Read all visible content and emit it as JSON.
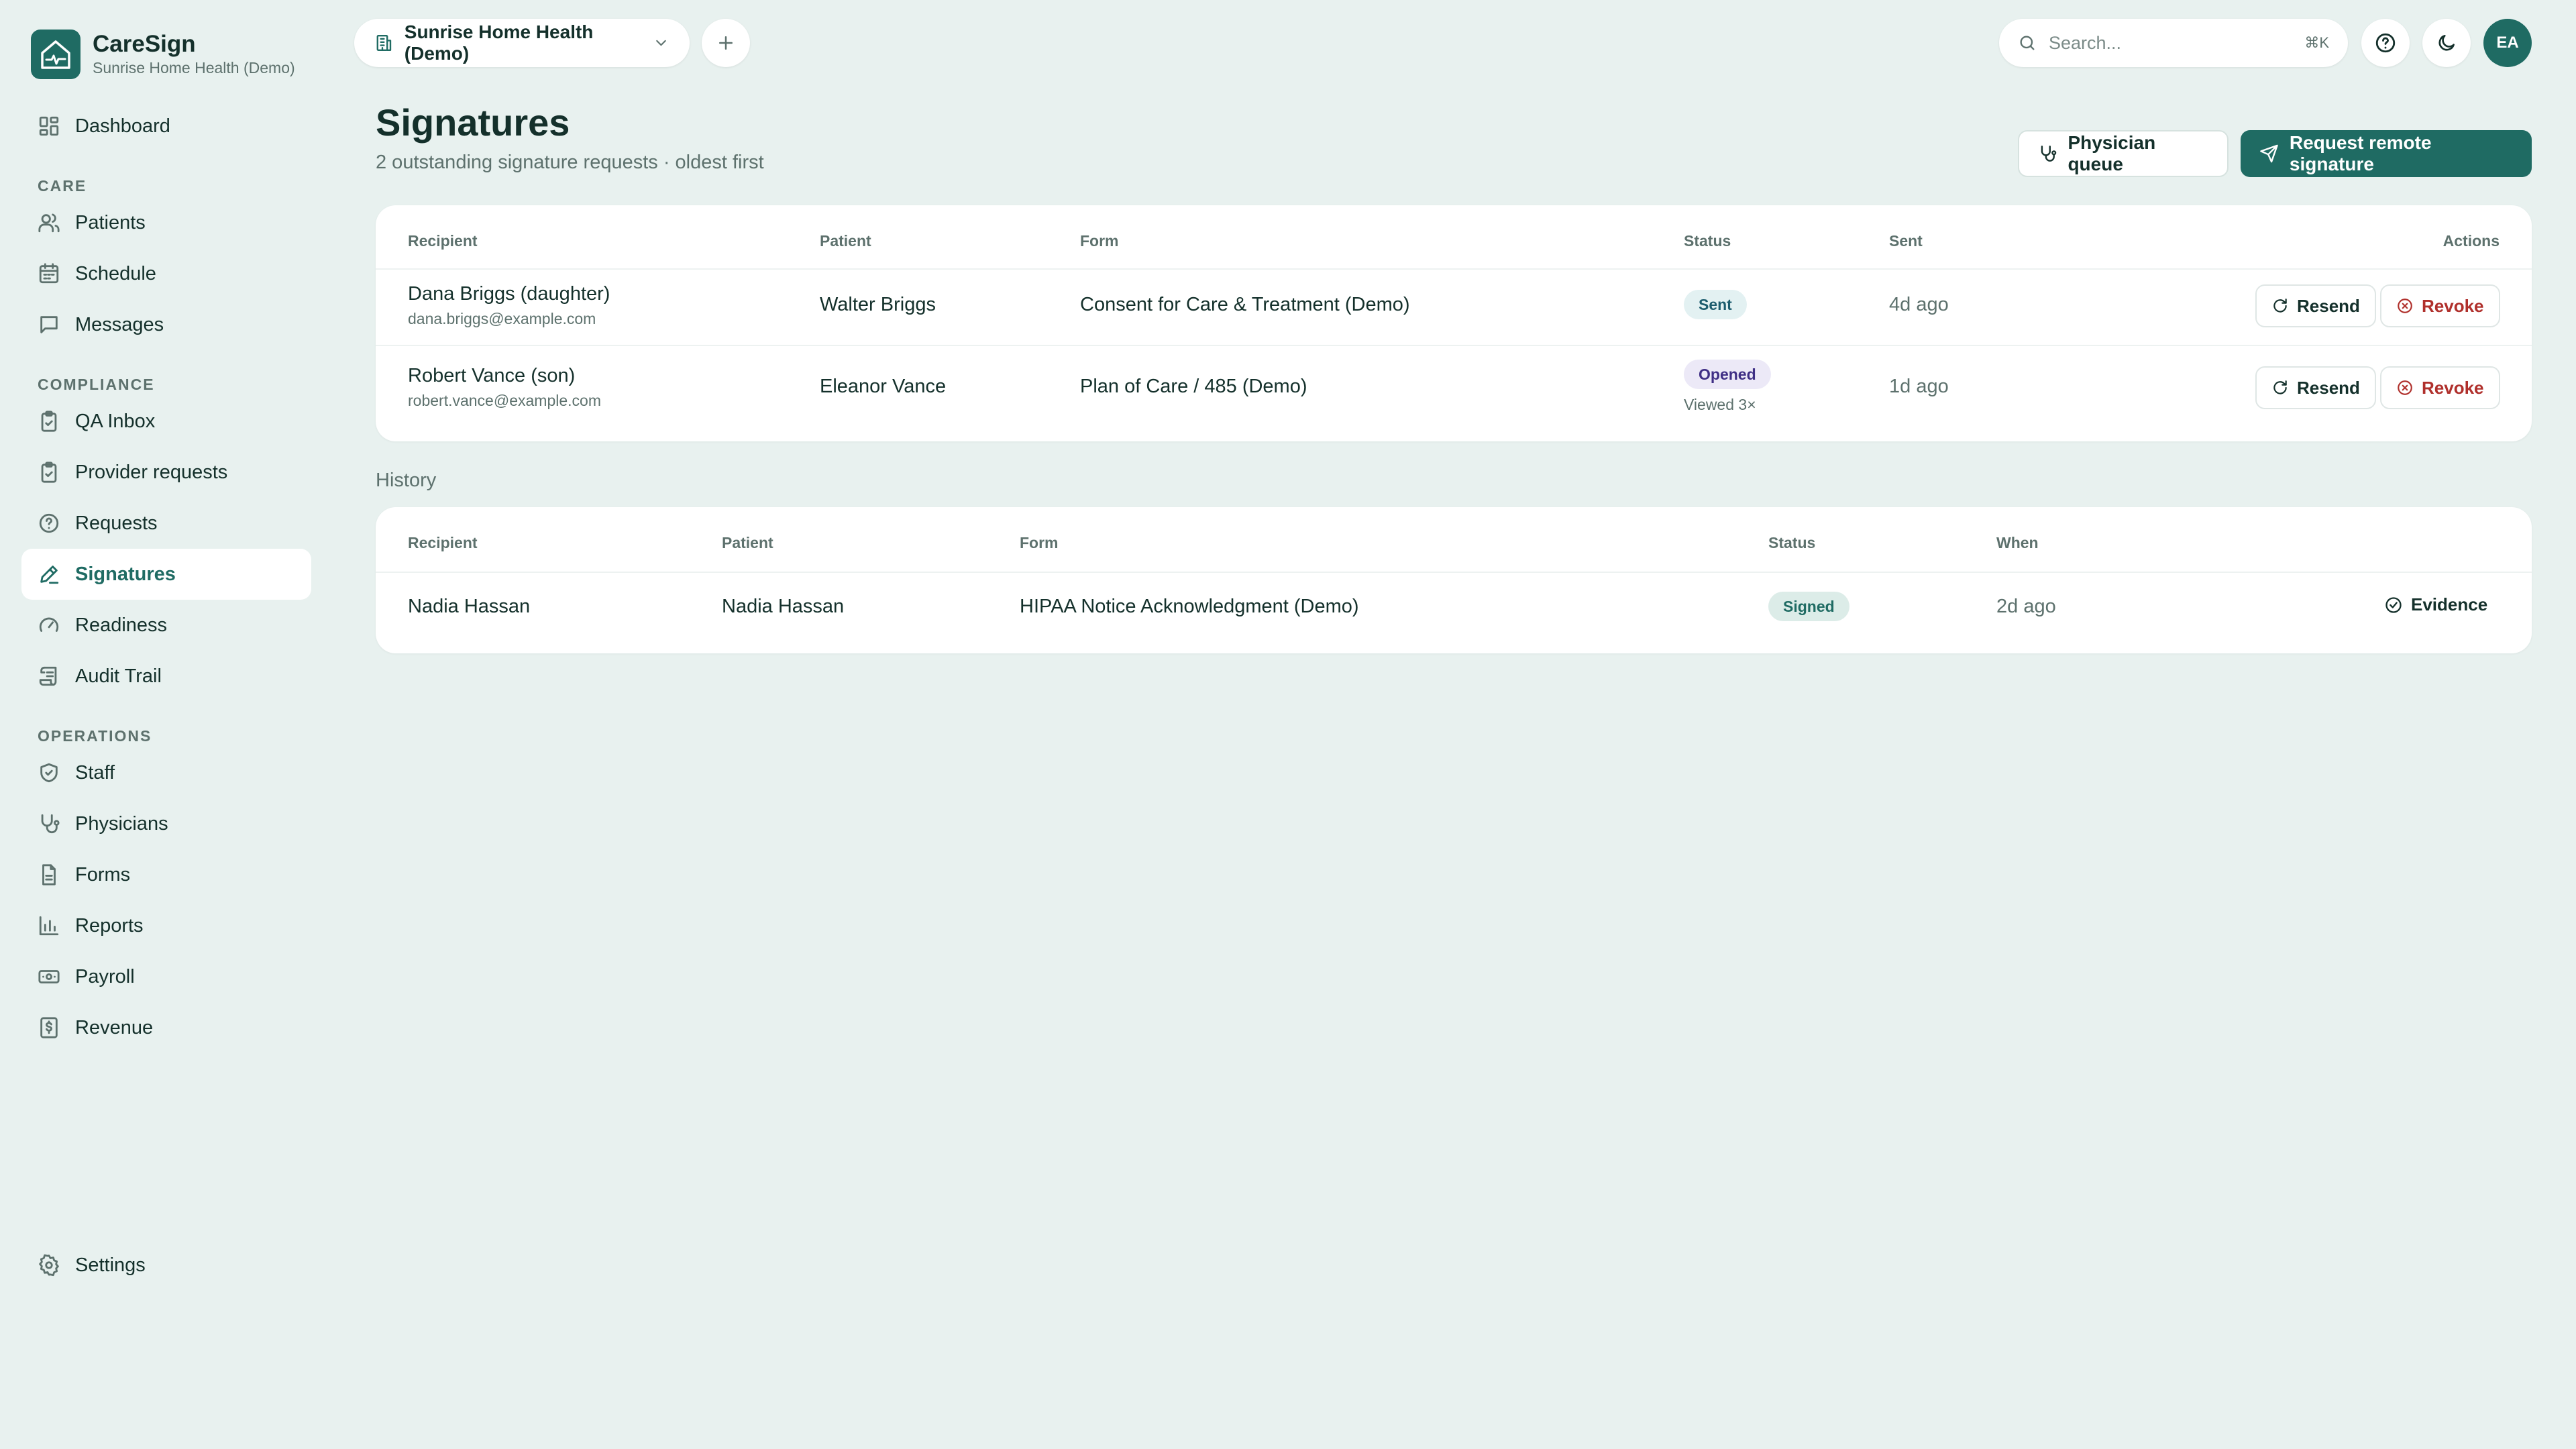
{
  "app": {
    "name": "CareSign",
    "org": "Sunrise Home Health (Demo)"
  },
  "nav": {
    "dashboard": "Dashboard",
    "sections": {
      "care": "CARE",
      "compliance": "COMPLIANCE",
      "operations": "OPERATIONS"
    },
    "care": [
      "Patients",
      "Schedule",
      "Messages"
    ],
    "compliance": [
      "QA Inbox",
      "Provider requests",
      "Requests",
      "Signatures",
      "Readiness",
      "Audit Trail"
    ],
    "operations": [
      "Staff",
      "Physicians",
      "Forms",
      "Reports",
      "Payroll",
      "Revenue"
    ],
    "settings": "Settings",
    "active": "Signatures"
  },
  "topbar": {
    "org_selector": "Sunrise Home Health (Demo)",
    "search_placeholder": "Search...",
    "search_shortcut": "⌘K",
    "avatar_initials": "EA"
  },
  "page": {
    "title": "Signatures",
    "subtitle": "2 outstanding signature requests · oldest first",
    "physician_queue": "Physician queue",
    "request_remote": "Request remote signature"
  },
  "outstanding": {
    "headers": {
      "recipient": "Recipient",
      "patient": "Patient",
      "form": "Form",
      "status": "Status",
      "sent": "Sent",
      "actions": "Actions"
    },
    "rows": [
      {
        "recipient": "Dana Briggs (daughter)",
        "email": "dana.briggs@example.com",
        "patient": "Walter Briggs",
        "form": "Consent for Care & Treatment (Demo)",
        "status": "Sent",
        "status_note": "",
        "sent": "4d ago",
        "resend": "Resend",
        "revoke": "Revoke"
      },
      {
        "recipient": "Robert Vance (son)",
        "email": "robert.vance@example.com",
        "patient": "Eleanor Vance",
        "form": "Plan of Care / 485 (Demo)",
        "status": "Opened",
        "status_note": "Viewed 3×",
        "sent": "1d ago",
        "resend": "Resend",
        "revoke": "Revoke"
      }
    ]
  },
  "history": {
    "label": "History",
    "headers": {
      "recipient": "Recipient",
      "patient": "Patient",
      "form": "Form",
      "status": "Status",
      "when": "When"
    },
    "rows": [
      {
        "recipient": "Nadia Hassan",
        "patient": "Nadia Hassan",
        "form": "HIPAA Notice Acknowledgment (Demo)",
        "status": "Signed",
        "when": "2d ago",
        "evidence": "Evidence"
      }
    ]
  }
}
